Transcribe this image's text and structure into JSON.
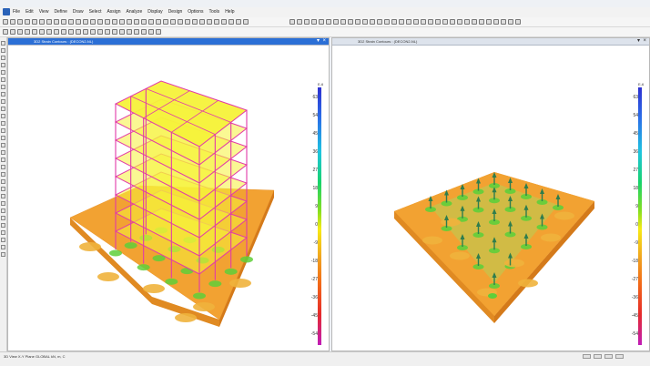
{
  "menu": [
    "File",
    "Edit",
    "View",
    "Define",
    "Draw",
    "Select",
    "Assign",
    "Analyze",
    "Display",
    "Design",
    "Options",
    "Tools",
    "Help"
  ],
  "left_pane": {
    "title": "3D2 Strain Contours : (DECON2-NL)",
    "legend_unit": "E-6",
    "legend_ticks": [
      "63",
      "54",
      "45",
      "36",
      "27",
      "18",
      "9",
      "0",
      "-9",
      "-18",
      "-27",
      "-36",
      "-45",
      "-54"
    ]
  },
  "right_pane": {
    "title": "3D2 Strain Contours : (DECON2-NL)",
    "legend_unit": "E-6",
    "legend_ticks": [
      "63",
      "54",
      "45",
      "36",
      "27",
      "18",
      "9",
      "0",
      "-9",
      "-18",
      "-27",
      "-36",
      "-45",
      "-54"
    ]
  },
  "status": {
    "text": "3D View  X-Y Plane  GLOBAL  kN, m, C"
  },
  "colors": {
    "slab": "#f2a232",
    "slab_dark": "#e08a22",
    "frame": "#e23aa8",
    "floor": "#f6f23a",
    "hotspot": "#5fcf3a",
    "column_force": "#2e7d4d"
  }
}
